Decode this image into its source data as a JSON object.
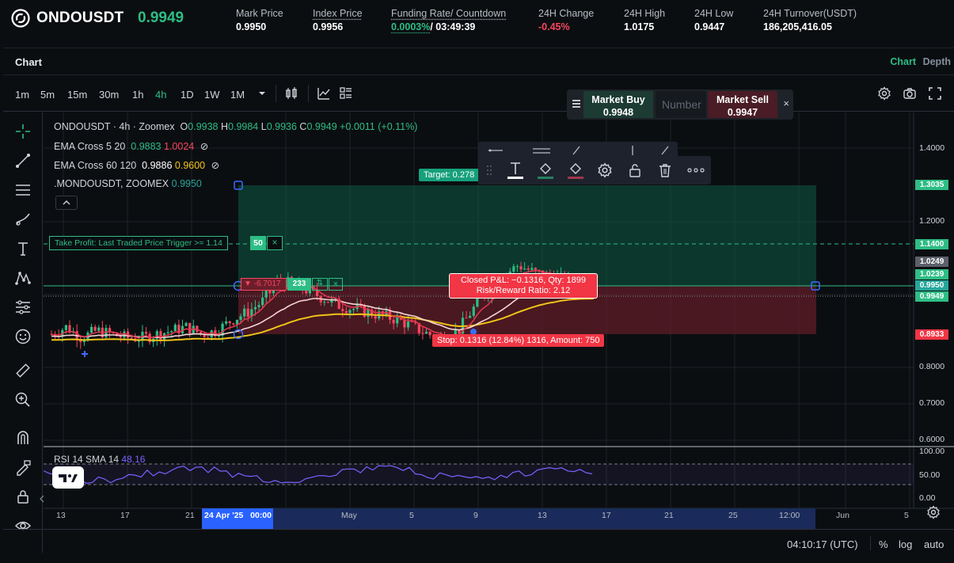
{
  "ticker": {
    "symbol": "ONDOUSDT",
    "last_price": "0.9949",
    "stats": [
      {
        "label": "Mark Price",
        "value": "0.9950"
      },
      {
        "label": "Index Price",
        "value": "0.9956"
      },
      {
        "label": "Funding Rate/ Countdown",
        "rate": "0.0003%",
        "countdown": "/ 03:49:39"
      },
      {
        "label": "24H Change",
        "value": "-0.45%"
      },
      {
        "label": "24H High",
        "value": "1.0175"
      },
      {
        "label": "24H Low",
        "value": "0.9447"
      },
      {
        "label": "24H Turnover(USDT)",
        "value": "186,205,416.05"
      }
    ]
  },
  "panel": {
    "title": "Chart",
    "tabs": [
      "Chart",
      "Depth"
    ]
  },
  "toolbar": {
    "timeframes": [
      "1m",
      "5m",
      "15m",
      "30m",
      "1h",
      "4h",
      "1D",
      "1W",
      "1M"
    ],
    "active_timeframe": "4h"
  },
  "market": {
    "buy_label": "Market Buy",
    "buy_price": "0.9948",
    "number_placeholder": "Number",
    "sell_label": "Market Sell",
    "sell_price": "0.9947",
    "close": "×"
  },
  "legend": {
    "main": {
      "name": "ONDOUSDT · 4h · Zoomex",
      "o": "O",
      "o_val": "0.9938",
      "h": "H",
      "h_val": "0.9984",
      "l": "L",
      "l_val": "0.9936",
      "c": "C",
      "c_val": "0.9949",
      "change": "+0.0011 (+0.11%)"
    },
    "ema1": {
      "name": "EMA Cross 5 20",
      "v1": "0.9883",
      "v2": "1.0024"
    },
    "ema2": {
      "name": "EMA Cross 60 120",
      "v1": "0.9886",
      "v2": "0.9600"
    },
    "mark": {
      "name": ".MONDOUSDT, ZOOMEX",
      "v": "0.9950"
    }
  },
  "orders": {
    "take_profit": "Take Profit: Last Traded Price Trigger >= 1.14",
    "take_profit_qty": "50",
    "entry_pnl": "-6.7017",
    "entry_qty": "233",
    "target": "Target: 0.278",
    "closed_line1": "Closed P&L: −0.1316, Qty: 1899",
    "closed_line2": "Risk/Reward Ratio: 2.12",
    "stop": "Stop: 0.1316 (12.84%) 1316, Amount: 750"
  },
  "price_axis": {
    "ticks": [
      "1.4000",
      "1.2000",
      "0.8000",
      "0.7000",
      "0.6000"
    ],
    "labels": [
      {
        "text": "1.3035",
        "kind": "green"
      },
      {
        "text": "1.1400",
        "kind": "green"
      },
      {
        "text": "1.0249",
        "kind": "gray"
      },
      {
        "text": "1.0239",
        "kind": "green"
      },
      {
        "text": "0.9950",
        "kind": "teal"
      },
      {
        "text": "0.9949",
        "kind": "green"
      },
      {
        "text": "0.8933",
        "kind": "red"
      }
    ]
  },
  "rsi": {
    "label": "RSI 14 SMA 14",
    "value": "48.16",
    "ticks": [
      "100.00",
      "50.00",
      "0.00"
    ]
  },
  "time_axis": {
    "labels": [
      "13",
      "17",
      "21",
      "May",
      "5",
      "9",
      "13",
      "17",
      "21",
      "25",
      "12:00",
      "Jun",
      "5"
    ],
    "cursor": "24 Apr '25   00:00"
  },
  "bottom": {
    "clock": "04:10:17 (UTC)",
    "percent": "%",
    "log": "log",
    "auto": "auto"
  },
  "colors": {
    "up": "#2ebd85",
    "down": "#f6465d",
    "ema_fast": "#f6465d",
    "ema_slow": "#ffffff",
    "ema_long": "#f0c419",
    "rsi": "#7b61ff"
  },
  "chart_data": {
    "type": "candlestick",
    "price_range": [
      0.55,
      1.45
    ],
    "x_labels": [
      "13",
      "17",
      "21",
      "24 Apr '25",
      "May",
      "5",
      "9",
      "13",
      "17"
    ],
    "approx_close_path": [
      0.86,
      0.88,
      0.85,
      0.87,
      0.86,
      0.85,
      0.85,
      0.86,
      0.87,
      0.88,
      0.86,
      0.87,
      0.9,
      0.92,
      0.95,
      1.0,
      1.0,
      0.98,
      0.96,
      0.94,
      0.93,
      0.92,
      0.91,
      0.9,
      0.88,
      0.86,
      0.85,
      0.87,
      0.93,
      0.98,
      1.02,
      1.05,
      1.03,
      1.02,
      1.01,
      0.99,
      0.995
    ]
  }
}
